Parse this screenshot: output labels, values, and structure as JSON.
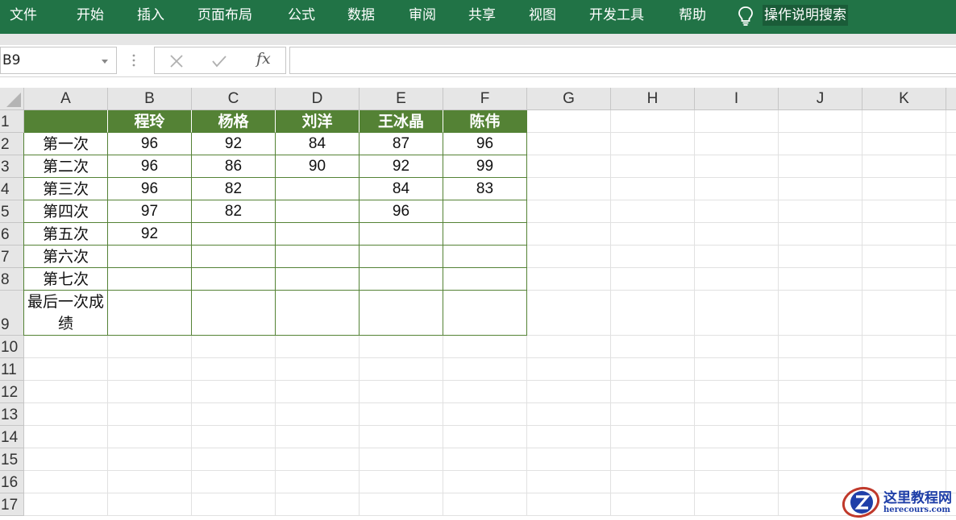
{
  "ribbon": {
    "menu": [
      "文件",
      "开始",
      "插入",
      "页面布局",
      "公式",
      "数据",
      "审阅",
      "共享",
      "视图",
      "开发工具",
      "帮助"
    ],
    "search_label": "操作说明搜索",
    "search_icon": "lightbulb-icon"
  },
  "formula_bar": {
    "name_box": "B9",
    "fx_label": "fx",
    "formula": ""
  },
  "columns": [
    "A",
    "B",
    "C",
    "D",
    "E",
    "F",
    "G",
    "H",
    "I",
    "J",
    "K"
  ],
  "rows": [
    "1",
    "2",
    "3",
    "4",
    "5",
    "6",
    "7",
    "8",
    "9",
    "10",
    "11",
    "12",
    "13",
    "14",
    "15",
    "16",
    "17"
  ],
  "table": {
    "header": [
      "",
      "程玲",
      "杨格",
      "刘洋",
      "王冰晶",
      "陈伟"
    ],
    "body": [
      [
        "第一次",
        "96",
        "92",
        "84",
        "87",
        "96"
      ],
      [
        "第二次",
        "96",
        "86",
        "90",
        "92",
        "99"
      ],
      [
        "第三次",
        "96",
        "82",
        "",
        "84",
        "83"
      ],
      [
        "第四次",
        "97",
        "82",
        "",
        "96",
        ""
      ],
      [
        "第五次",
        "92",
        "",
        "",
        "",
        ""
      ],
      [
        "第六次",
        "",
        "",
        "",
        "",
        ""
      ],
      [
        "第七次",
        "",
        "",
        "",
        "",
        ""
      ],
      [
        "最后一次成绩",
        "",
        "",
        "",
        "",
        ""
      ]
    ]
  },
  "colors": {
    "ribbon": "#217346",
    "table_header": "#548235",
    "table_border": "#548235"
  },
  "watermark": {
    "title": "这里教程网",
    "url": "herecours.com"
  }
}
